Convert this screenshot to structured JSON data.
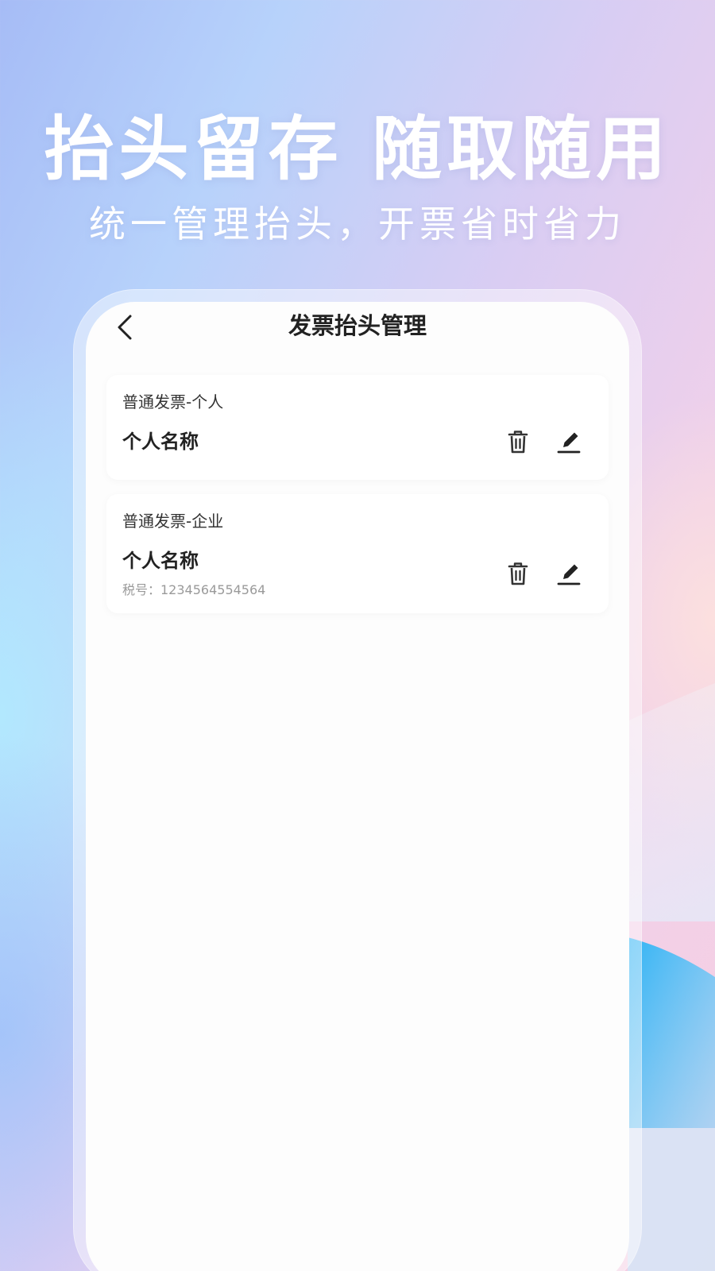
{
  "hero": {
    "title": "抬头留存 随取随用",
    "subtitle": "统一管理抬头，开票省时省力"
  },
  "colors": {
    "screen_bg": "#fdfdfd",
    "text_primary": "#222222",
    "text_muted": "#9a9a9a",
    "accent_blue": "#1ab0f5"
  },
  "nav": {
    "back_icon": "chevron-left-icon",
    "title": "发票抬头管理"
  },
  "invoices": [
    {
      "type": "普通发票-个人",
      "name": "个人名称",
      "delete_icon": "trash-icon",
      "edit_icon": "pencil-icon"
    },
    {
      "type": "普通发票-企业",
      "name": "个人名称",
      "tax": "税号：1234564554564",
      "delete_icon": "trash-icon",
      "edit_icon": "pencil-icon"
    }
  ]
}
